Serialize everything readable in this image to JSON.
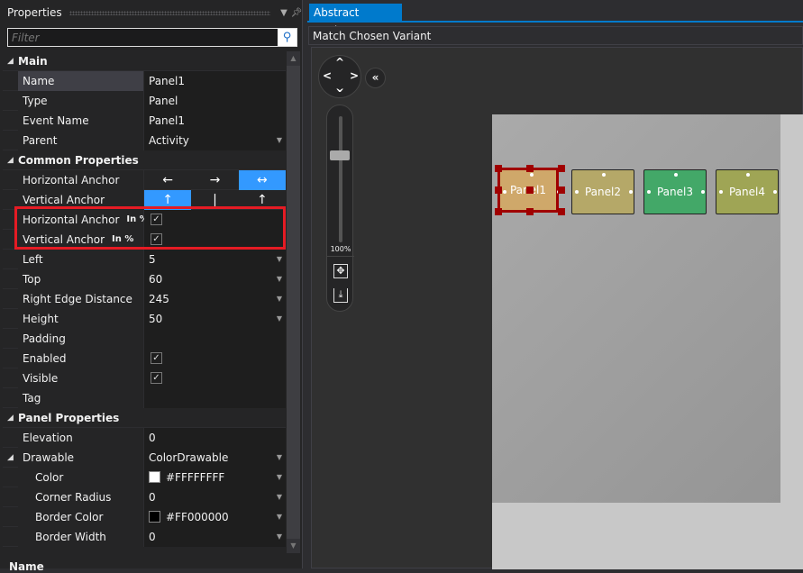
{
  "properties_panel": {
    "title": "Properties",
    "dropdown_icon": "chevron-down-icon",
    "pin_icon": "pin-icon",
    "filter": {
      "placeholder": "Filter",
      "value": ""
    },
    "rows": [
      {
        "kind": "cat",
        "label": "Main"
      },
      {
        "label": "Name",
        "value": "Panel1",
        "selected": true
      },
      {
        "label": "Type",
        "value": "Panel"
      },
      {
        "label": "Event Name",
        "value": "Panel1"
      },
      {
        "label": "Parent",
        "value": "Activity",
        "dropdown": true
      },
      {
        "kind": "cat",
        "label": "Common Properties"
      },
      {
        "kind": "anchor",
        "label": "Horizontal Anchor",
        "options": [
          "←",
          "→",
          "↔"
        ],
        "active": 2
      },
      {
        "kind": "anchor",
        "label": "Vertical Anchor",
        "options": [
          "↑",
          "|",
          "↑"
        ],
        "active": 0
      },
      {
        "kind": "check",
        "label": "Horizontal Anchor",
        "badge": "In %",
        "checked": true
      },
      {
        "kind": "check",
        "label": "Vertical Anchor",
        "badge": "In %",
        "checked": true
      },
      {
        "label": "Left",
        "value": "5",
        "dropdown": true
      },
      {
        "label": "Top",
        "value": "60",
        "dropdown": true
      },
      {
        "label": "Right Edge Distance",
        "value": "245",
        "dropdown": true
      },
      {
        "label": "Height",
        "value": "50",
        "dropdown": true
      },
      {
        "label": "Padding",
        "value": ""
      },
      {
        "kind": "check",
        "label": "Enabled",
        "checked": true
      },
      {
        "kind": "check",
        "label": "Visible",
        "checked": true
      },
      {
        "label": "Tag",
        "value": ""
      },
      {
        "kind": "cat",
        "label": "Panel Properties"
      },
      {
        "label": "Elevation",
        "value": "0"
      },
      {
        "label": "Drawable",
        "value": "ColorDrawable",
        "dropdown": true,
        "expander": true
      },
      {
        "label": "Color",
        "value": "#FFFFFFFF",
        "swatch": "#ffffff",
        "dropdown": true,
        "sub": true
      },
      {
        "label": "Corner Radius",
        "value": "0",
        "dropdown": true,
        "sub": true
      },
      {
        "label": "Border Color",
        "value": "#FF000000",
        "swatch": "#000000",
        "dropdown": true,
        "sub": true
      },
      {
        "label": "Border Width",
        "value": "0",
        "dropdown": true,
        "sub": true
      }
    ],
    "footer_label": "Name"
  },
  "designer": {
    "tab": "Abstract Designer",
    "toolbar_label": "Match Chosen Variant",
    "zoom_level": "100%",
    "panels": [
      {
        "label": "Panel1",
        "color": "#cfa86a",
        "selected": true
      },
      {
        "label": "Panel2",
        "color": "#b5a868"
      },
      {
        "label": "Panel3",
        "color": "#43a868"
      },
      {
        "label": "Panel4",
        "color": "#9fa555"
      }
    ],
    "highlight_color": "#e51b24",
    "selection_color": "#a00000"
  }
}
